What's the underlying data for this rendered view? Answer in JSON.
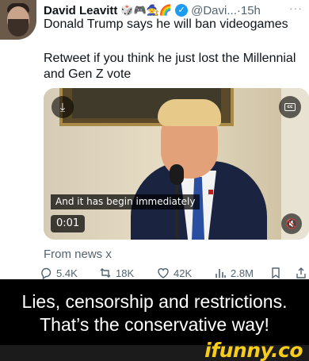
{
  "tweet": {
    "author_name": "David Leavitt",
    "name_emojis": "🎲🎮🧙🌈",
    "verified_glyph": "✓",
    "handle": "@Davi...",
    "separator": "·",
    "time": "15h",
    "more_glyph": "···",
    "line1": "Donald Trump says he will ban videogames",
    "line2": "Retweet if you think he just lost the Millennial and Gen Z vote",
    "video": {
      "download_icon": "download-icon",
      "cc_label": "cc",
      "caption": "And it has begin immediately",
      "timestamp": "0:01",
      "mute_icon": "speaker-muted-icon"
    },
    "source": "From news x",
    "actions": {
      "replies": "5.4K",
      "retweets": "18K",
      "likes": "42K",
      "views": "2.8M"
    }
  },
  "meme_caption": "Lies, censorship and restrictions. That’s the conservative way!",
  "watermark": "ifunny.co",
  "colors": {
    "accent_blue": "#1d9bf0",
    "muted_gray": "#536471",
    "ifunny_yellow": "#f7cc1a"
  }
}
